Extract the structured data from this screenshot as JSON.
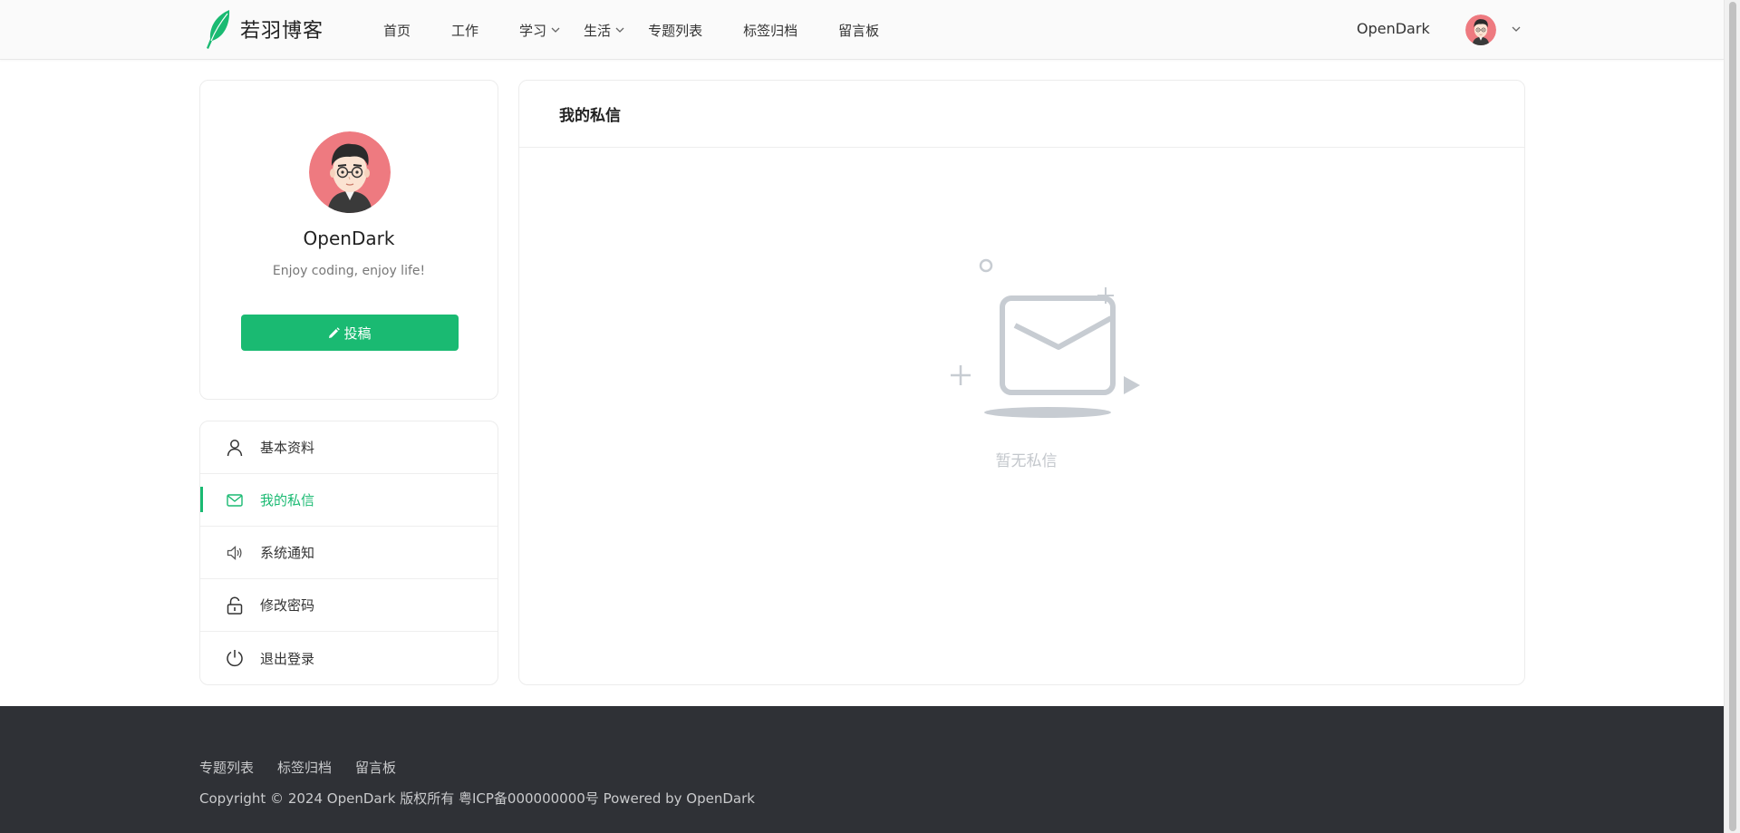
{
  "brand": {
    "name": "若羽博客",
    "accent": "#1aba72"
  },
  "nav": {
    "items": [
      {
        "label": "首页",
        "dropdown": false
      },
      {
        "label": "工作",
        "dropdown": false
      },
      {
        "label": "学习",
        "dropdown": true
      },
      {
        "label": "生活",
        "dropdown": true
      },
      {
        "label": "专题列表",
        "dropdown": false
      },
      {
        "label": "标签归档",
        "dropdown": false
      },
      {
        "label": "留言板",
        "dropdown": false
      }
    ],
    "username": "OpenDark"
  },
  "profile": {
    "name": "OpenDark",
    "bio": "Enjoy coding, enjoy life!",
    "post_button": "投稿"
  },
  "menu": {
    "items": [
      {
        "label": "基本资料",
        "icon": "user-icon",
        "active": false
      },
      {
        "label": "我的私信",
        "icon": "mail-icon",
        "active": true
      },
      {
        "label": "系统通知",
        "icon": "speaker-icon",
        "active": false
      },
      {
        "label": "修改密码",
        "icon": "unlock-icon",
        "active": false
      },
      {
        "label": "退出登录",
        "icon": "power-icon",
        "active": false
      }
    ]
  },
  "main": {
    "title": "我的私信",
    "empty_text": "暂无私信"
  },
  "footer": {
    "links": [
      "专题列表",
      "标签归档",
      "留言板"
    ],
    "copyright": "Copyright © 2024 OpenDark 版权所有 粤ICP备000000000号 Powered by OpenDark"
  }
}
